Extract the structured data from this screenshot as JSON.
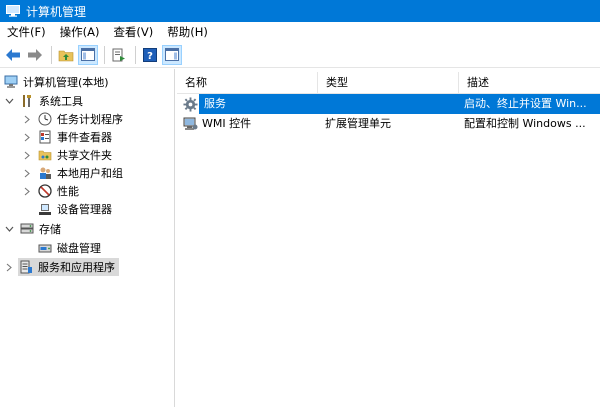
{
  "window": {
    "title": "计算机管理"
  },
  "menu": [
    "文件(F)",
    "操作(A)",
    "查看(V)",
    "帮助(H)"
  ],
  "tree": {
    "root": "计算机管理(本地)",
    "system_tools": "系统工具",
    "task_scheduler": "任务计划程序",
    "event_viewer": "事件查看器",
    "shared_folders": "共享文件夹",
    "local_users": "本地用户和组",
    "performance": "性能",
    "device_manager": "设备管理器",
    "storage": "存储",
    "disk_management": "磁盘管理",
    "services_apps": "服务和应用程序"
  },
  "list": {
    "columns": [
      "名称",
      "类型",
      "描述"
    ],
    "rows": [
      {
        "name": "服务",
        "type": "",
        "desc": "启动、终止并设置 Win..."
      },
      {
        "name": "WMI 控件",
        "type": "扩展管理单元",
        "desc": "配置和控制 Windows ..."
      }
    ]
  },
  "colors": {
    "accent": "#0078d7",
    "selected_tree": "#d9d9d9"
  }
}
